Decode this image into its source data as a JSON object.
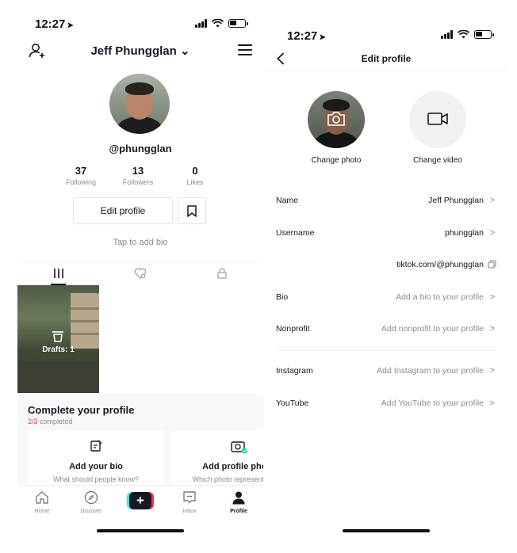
{
  "status_left": {
    "time": "12:27",
    "location_arrow": "➤"
  },
  "status_right": {
    "time": "12:27",
    "location_arrow": "➤"
  },
  "profile": {
    "display_name": "Jeff Phungglan",
    "handle": "@phungglan",
    "stats": [
      {
        "value": "37",
        "label": "Following"
      },
      {
        "value": "13",
        "label": "Followers"
      },
      {
        "value": "0",
        "label": "Likes"
      }
    ],
    "edit_button": "Edit profile",
    "bio_hint": "Tap to add bio",
    "drafts_label": "Drafts: 1"
  },
  "complete": {
    "title": "Complete your profile",
    "progress_done": "2/3",
    "progress_suffix": " completed",
    "cards": [
      {
        "title": "Add your bio",
        "subtitle": "What should people know?",
        "icon": "edit-note-icon"
      },
      {
        "title": "Add profile photo",
        "subtitle": "Which photo represents you?",
        "icon": "camera-check-icon"
      }
    ]
  },
  "bottom_nav": [
    {
      "label": "Home",
      "icon": "home-icon"
    },
    {
      "label": "Discover",
      "icon": "compass-icon"
    },
    {
      "label": "",
      "icon": "plus-icon"
    },
    {
      "label": "Inbox",
      "icon": "inbox-icon"
    },
    {
      "label": "Profile",
      "icon": "person-icon"
    }
  ],
  "edit_profile": {
    "title": "Edit profile",
    "change_photo": "Change photo",
    "change_video": "Change video",
    "fields": [
      {
        "key": "Name",
        "value": "Jeff Phungglan"
      },
      {
        "key": "Username",
        "value": "phungglan"
      },
      {
        "key": "",
        "value": "tiktok.com/@phungglan"
      },
      {
        "key": "Bio",
        "value": "Add a bio to your profile"
      },
      {
        "key": "Nonprofit",
        "value": "Add nonprofit to your profile"
      },
      {
        "key": "Instagram",
        "value": "Add Instagram to your profile"
      },
      {
        "key": "YouTube",
        "value": "Add YouTube to your profile"
      }
    ]
  },
  "colors": {
    "accent_red": "#fe2c55",
    "accent_cyan": "#25f4ee",
    "text_dark": "#161823",
    "text_muted": "#8a8b91"
  }
}
